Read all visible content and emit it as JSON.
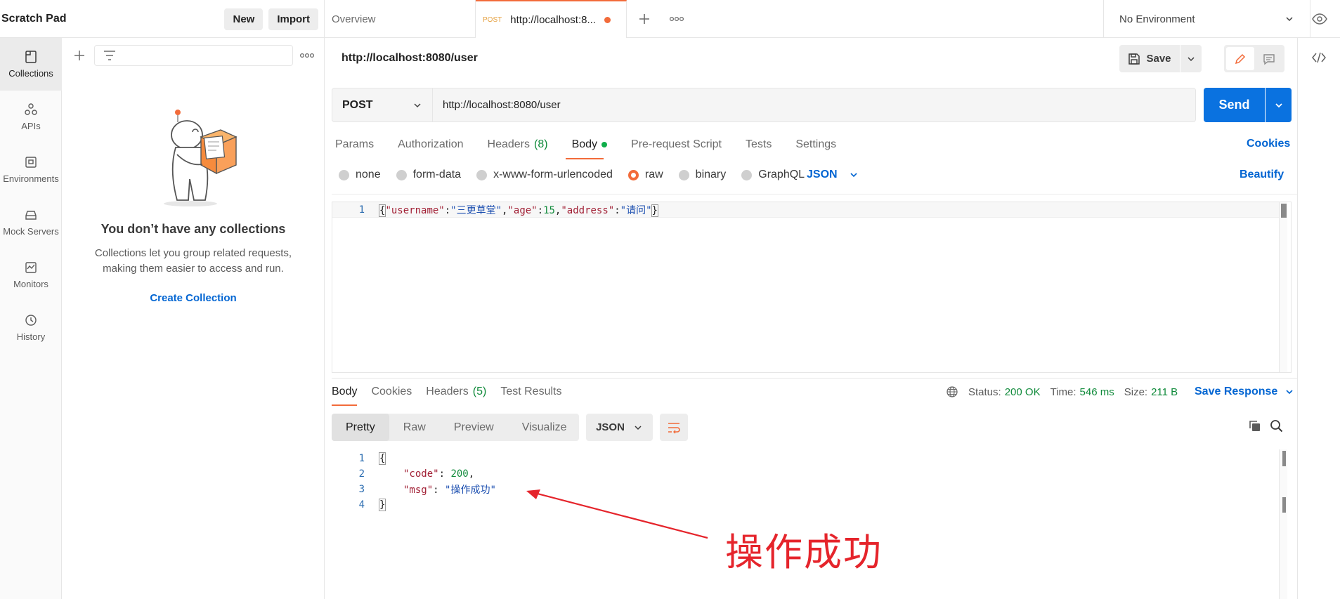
{
  "scratch_pad": {
    "title": "Scratch Pad",
    "new_label": "New",
    "import_label": "Import"
  },
  "tabs": {
    "overview_label": "Overview",
    "active": {
      "method": "POST",
      "name": "http://localhost:8..."
    }
  },
  "environment": {
    "selected": "No Environment"
  },
  "sidebar": {
    "items": [
      {
        "label": "Collections",
        "icon": "collections-icon"
      },
      {
        "label": "APIs",
        "icon": "apis-icon"
      },
      {
        "label": "Environments",
        "icon": "environments-icon"
      },
      {
        "label": "Mock Servers",
        "icon": "mock-servers-icon"
      },
      {
        "label": "Monitors",
        "icon": "monitors-icon"
      },
      {
        "label": "History",
        "icon": "history-icon"
      }
    ]
  },
  "collections": {
    "empty_title": "You don’t have any collections",
    "empty_desc": "Collections let you group related requests, making them easier to access and run.",
    "create_label": "Create Collection"
  },
  "request": {
    "title": "http://localhost:8080/user",
    "save_label": "Save",
    "method": "POST",
    "url": "http://localhost:8080/user",
    "send_label": "Send",
    "tabs": {
      "params": "Params",
      "authorization": "Authorization",
      "headers": "Headers",
      "headers_count": "(8)",
      "body": "Body",
      "prerequest": "Pre-request Script",
      "tests": "Tests",
      "settings": "Settings"
    },
    "cookies_label": "Cookies",
    "body_types": {
      "none": "none",
      "form_data": "form-data",
      "urlencoded": "x-www-form-urlencoded",
      "raw": "raw",
      "binary": "binary",
      "graphql": "GraphQL"
    },
    "selected_body_type": "raw",
    "language": "JSON",
    "beautify_label": "Beautify",
    "body_line_number": "1",
    "body_tokens": {
      "open": "{",
      "k1": "\"username\"",
      "c1": ":",
      "v1": "\"三更草堂\"",
      "s1": ",",
      "k2": "\"age\"",
      "c2": ":",
      "v2": "15",
      "s2": ",",
      "k3": "\"address\"",
      "c3": ":",
      "v3": "\"请问\"",
      "close": "}"
    }
  },
  "response": {
    "tabs": {
      "body": "Body",
      "cookies": "Cookies",
      "headers": "Headers",
      "headers_count": "(5)",
      "test_results": "Test Results"
    },
    "status_label": "Status:",
    "status_value": "200 OK",
    "time_label": "Time:",
    "time_value": "546 ms",
    "size_label": "Size:",
    "size_value": "211 B",
    "save_label": "Save Response",
    "view_modes": {
      "pretty": "Pretty",
      "raw": "Raw",
      "preview": "Preview",
      "visualize": "Visualize"
    },
    "language": "JSON",
    "lines": {
      "n1": "1",
      "n2": "2",
      "n3": "3",
      "n4": "4",
      "open": "{",
      "code_key": "\"code\"",
      "code_colon": ": ",
      "code_val": "200",
      "code_comma": ",",
      "msg_key": "\"msg\"",
      "msg_colon": ": ",
      "msg_val": "\"操作成功\"",
      "close": "}"
    }
  },
  "annotation": {
    "text": "操作成功",
    "color": "#e5242b"
  },
  "colors": {
    "accent": "#f26b3a",
    "primary": "#0a72e0",
    "link": "#0265d2",
    "success": "#0f8a3a"
  }
}
